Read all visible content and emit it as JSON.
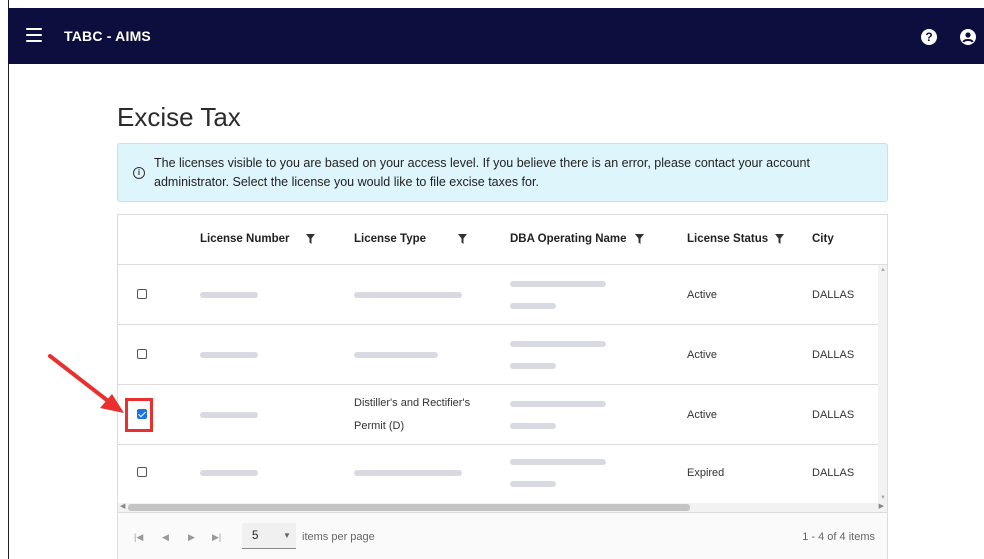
{
  "app": {
    "title": "TABC - AIMS",
    "help_glyph": "?"
  },
  "page": {
    "title": "Excise Tax"
  },
  "alert": {
    "text": "The licenses visible to you are based on your access level. If you believe there is an error, please contact your account administrator. Select the license you would like to file excise taxes for."
  },
  "table": {
    "columns": [
      "License Number",
      "License Type",
      "DBA Operating Name",
      "License Status",
      "City"
    ],
    "rows": [
      {
        "checked": false,
        "license_type": "",
        "license_status": "Active",
        "city": "DALLAS"
      },
      {
        "checked": false,
        "license_type": "",
        "license_status": "Active",
        "city": "DALLAS"
      },
      {
        "checked": true,
        "license_type": "Distiller's and Rectifier's Permit (D)",
        "license_type_line1": "Distiller's and Rectifier's",
        "license_type_line2": "Permit (D)",
        "license_status": "Active",
        "city": "DALLAS"
      },
      {
        "checked": false,
        "license_type": "",
        "license_status": "Expired",
        "city": "DALLAS"
      }
    ]
  },
  "pager": {
    "page_size": "5",
    "per_page_label": "items per page",
    "info": "1 - 4 of 4 items"
  },
  "colors": {
    "topbar": "#0c0f3d",
    "alert_bg": "#def5fb",
    "highlight": "#e8312f",
    "checkbox": "#1a73e8"
  }
}
